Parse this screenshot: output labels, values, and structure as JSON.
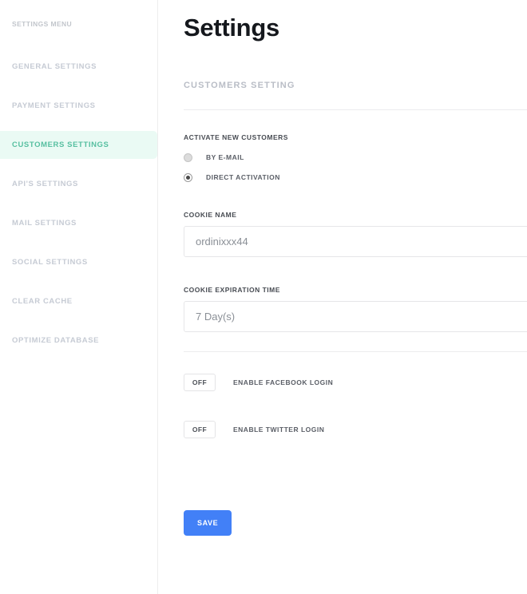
{
  "sidebar": {
    "menu_title": "SETTINGS MENU",
    "items": [
      {
        "label": "GENERAL SETTINGS",
        "active": false
      },
      {
        "label": "PAYMENT SETTINGS",
        "active": false
      },
      {
        "label": "CUSTOMERS SETTINGS",
        "active": true
      },
      {
        "label": "API'S SETTINGS",
        "active": false
      },
      {
        "label": "MAIL SETTINGS",
        "active": false
      },
      {
        "label": "SOCIAL SETTINGS",
        "active": false
      },
      {
        "label": "CLEAR CACHE",
        "active": false
      },
      {
        "label": "OPTIMIZE DATABASE",
        "active": false
      }
    ],
    "active_bg": "#eafaf4",
    "active_text": "#56bfa0",
    "text": "#c6cbd4"
  },
  "main": {
    "page_title": "Settings",
    "section_title": "CUSTOMERS SETTING",
    "activate": {
      "label": "ACTIVATE NEW CUSTOMERS",
      "options": [
        {
          "label": "BY E-MAIL",
          "selected": false
        },
        {
          "label": "DIRECT ACTIVATION",
          "selected": true
        }
      ]
    },
    "cookie_name": {
      "label": "COOKIE NAME",
      "value": "ordinixxx44",
      "placeholder": "ordinixxx44"
    },
    "cookie_expiration": {
      "label": "COOKIE EXPIRATION TIME",
      "value": "7 Day(s)"
    },
    "toggles": [
      {
        "state": "OFF",
        "label": "ENABLE FACEBOOK LOGIN"
      },
      {
        "state": "OFF",
        "label": "ENABLE TWITTER LOGIN"
      }
    ],
    "save_label": "SAVE",
    "save_color": "#4280f7"
  }
}
